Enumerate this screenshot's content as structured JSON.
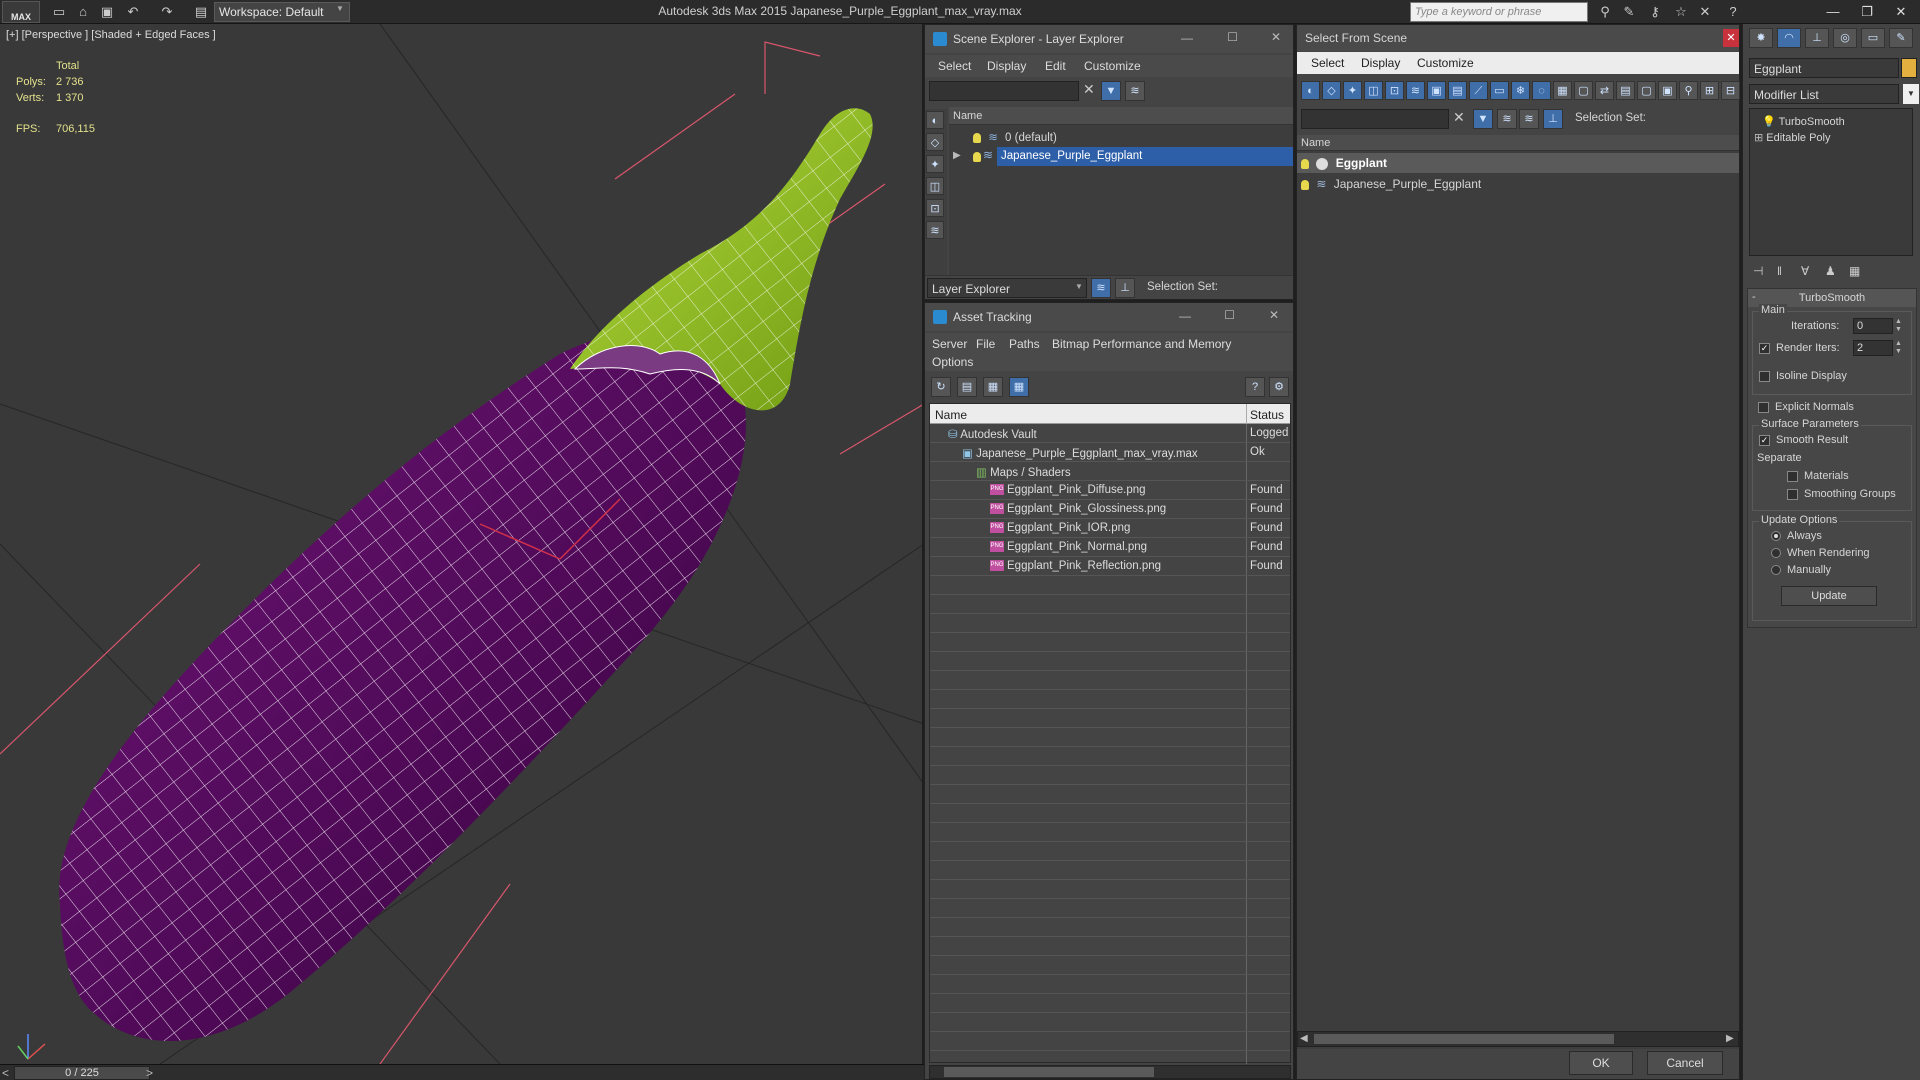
{
  "titlebar": {
    "logo": "MAX",
    "workspace": "Workspace: Default",
    "title": "Autodesk 3ds Max  2015     Japanese_Purple_Eggplant_max_vray.max",
    "search_placeholder": "Type a keyword or phrase"
  },
  "viewport": {
    "label": "[+] [Perspective ] [Shaded + Edged Faces ]",
    "stats": {
      "total_label": "Total",
      "polys_label": "Polys:",
      "polys_value": "2 736",
      "verts_label": "Verts:",
      "verts_value": "1 370",
      "fps_label": "FPS:",
      "fps_value": "706,115"
    },
    "timeline": "0 / 225",
    "colors": {
      "eggplant": "#5a0a5e",
      "stem": "#9ac41e",
      "wire": "#ffffff",
      "bg": "#393939"
    }
  },
  "scene_explorer": {
    "title": "Scene Explorer - Layer Explorer",
    "menu": [
      "Select",
      "Display",
      "Edit",
      "Customize"
    ],
    "column_name": "Name",
    "rows": [
      "0 (default)",
      "Japanese_Purple_Eggplant"
    ],
    "footer_combo": "Layer Explorer",
    "selection_set_label": "Selection Set:"
  },
  "asset_tracking": {
    "title": "Asset Tracking",
    "menu": [
      "Server",
      "File",
      "Paths",
      "Bitmap Performance and Memory"
    ],
    "menu2": "Options",
    "col_name": "Name",
    "col_status": "Status",
    "rows": [
      {
        "name": "Autodesk Vault",
        "status": "Logged",
        "indent": 0,
        "icon": "vault"
      },
      {
        "name": "Japanese_Purple_Eggplant_max_vray.max",
        "status": "Ok",
        "indent": 1,
        "icon": "max"
      },
      {
        "name": "Maps / Shaders",
        "status": "",
        "indent": 2,
        "icon": "maps"
      },
      {
        "name": "Eggplant_Pink_Diffuse.png",
        "status": "Found",
        "indent": 3,
        "icon": "png"
      },
      {
        "name": "Eggplant_Pink_Glossiness.png",
        "status": "Found",
        "indent": 3,
        "icon": "png"
      },
      {
        "name": "Eggplant_Pink_IOR.png",
        "status": "Found",
        "indent": 3,
        "icon": "png"
      },
      {
        "name": "Eggplant_Pink_Normal.png",
        "status": "Found",
        "indent": 3,
        "icon": "png"
      },
      {
        "name": "Eggplant_Pink_Reflection.png",
        "status": "Found",
        "indent": 3,
        "icon": "png"
      }
    ]
  },
  "select_from_scene": {
    "title": "Select From Scene",
    "menu": [
      "Select",
      "Display",
      "Customize"
    ],
    "selection_set_label": "Selection Set:",
    "column_name": "Name",
    "rows": [
      "Eggplant",
      "Japanese_Purple_Eggplant"
    ],
    "ok": "OK",
    "cancel": "Cancel"
  },
  "command_panel": {
    "object_name": "Eggplant",
    "modifier_list": "Modifier List",
    "stack": [
      "TurboSmooth",
      "Editable Poly"
    ],
    "rollout_title": "TurboSmooth",
    "main_group": "Main",
    "iterations_label": "Iterations:",
    "iterations_value": "0",
    "render_iters_label": "Render Iters:",
    "render_iters_value": "2",
    "isoline": "Isoline Display",
    "explicit_normals": "Explicit Normals",
    "surface_params": "Surface Parameters",
    "smooth_result": "Smooth Result",
    "separate": "Separate",
    "materials": "Materials",
    "smoothing_groups": "Smoothing Groups",
    "update_options": "Update Options",
    "always": "Always",
    "when_rendering": "When Rendering",
    "manually": "Manually",
    "update_button": "Update"
  }
}
